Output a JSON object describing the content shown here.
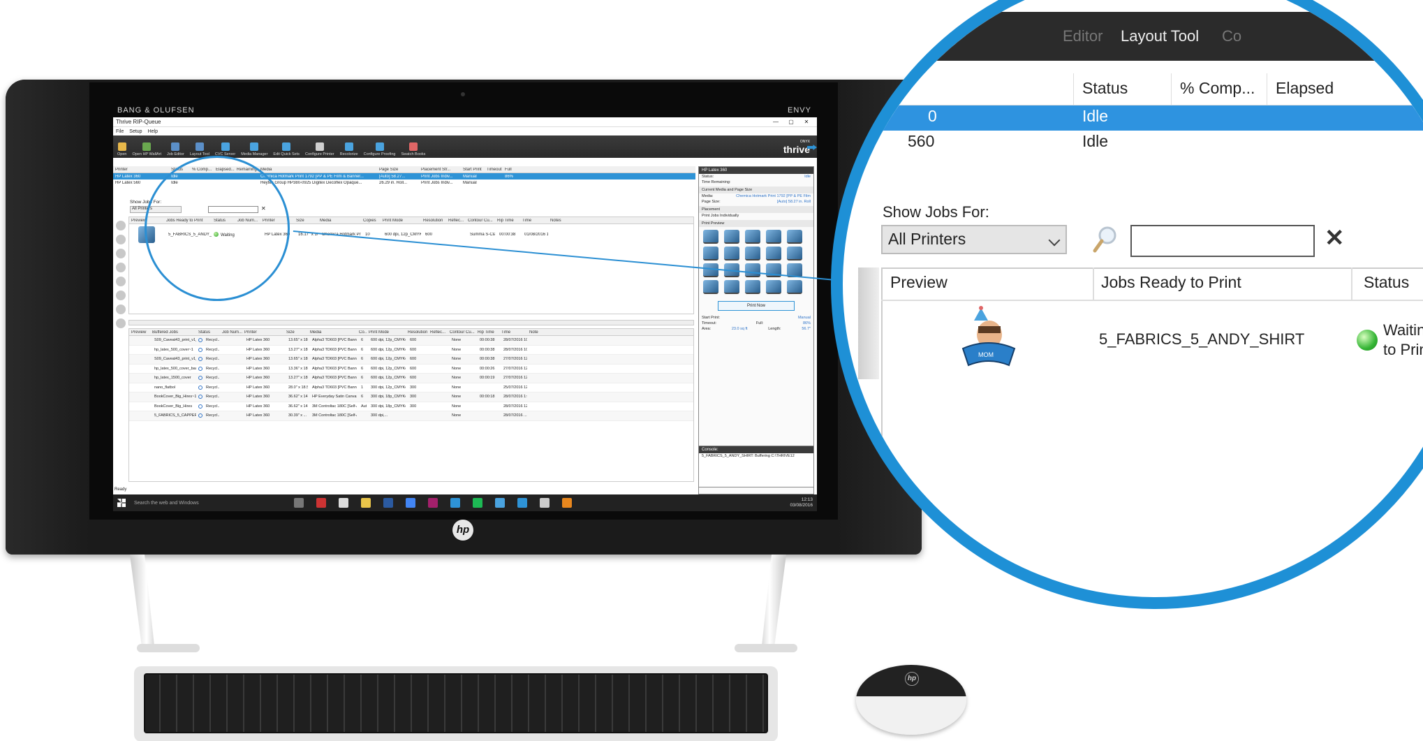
{
  "monitor": {
    "brand_left": "BANG & OLUFSEN",
    "brand_right": "ENVY"
  },
  "window": {
    "title": "Thrive RIP-Queue",
    "controls": [
      "—",
      "▢",
      "✕"
    ]
  },
  "menu": [
    "File",
    "Setup",
    "Help"
  ],
  "toolbar": [
    {
      "label": "Open",
      "icon": "folder-icon",
      "color": "#e8b84a"
    },
    {
      "label": "Open HP WallArt",
      "icon": "wallart-icon",
      "color": "#6aa84f"
    },
    {
      "label": "Job Editor",
      "icon": "job-editor-icon",
      "color": "#5b8fc8"
    },
    {
      "label": "Layout Tool",
      "icon": "layout-tool-icon",
      "color": "#5b8fc8"
    },
    {
      "label": "CVC Server",
      "icon": "cvc-server-icon",
      "color": "#4aa3df"
    },
    {
      "label": "Media Manager",
      "icon": "media-manager-icon",
      "color": "#4aa3df"
    },
    {
      "label": "Edit Quick Sets",
      "icon": "quick-sets-icon",
      "color": "#4aa3df"
    },
    {
      "label": "Configure Printer",
      "icon": "printer-icon",
      "color": "#cfcfcf"
    },
    {
      "label": "Recolorize",
      "icon": "recolorize-icon",
      "color": "#4aa3df"
    },
    {
      "label": "Configure Proofing",
      "icon": "proofing-icon",
      "color": "#4aa3df"
    },
    {
      "label": "Swatch Books",
      "icon": "swatch-books-icon",
      "color": "#e06666"
    }
  ],
  "brand": {
    "small": "ONYX",
    "name": "thrive"
  },
  "printer_grid": {
    "headers": [
      "Printer",
      "Status",
      "% Comp...",
      "Elapsed...",
      "Remaining...",
      "Media",
      "Page Size",
      "Placement Str...",
      "Start Print",
      "Timeout",
      "Full"
    ],
    "rows": [
      {
        "printer": "HP Latex 360",
        "status": "Idle",
        "media": "Chemica Hotmark Print 1792 [PP & PE Film & Banner...",
        "page_size": "[Auto] 58.27...",
        "placement": "Print Jobs Indiv...",
        "start": "Manual",
        "full": "86%"
      },
      {
        "printer": "HP Latex 560",
        "status": "Idle",
        "media": "Heytex Group HP380-0925 Digitex Decoflex Opaque...",
        "page_size": "26.29 in. Roll...",
        "placement": "Print Jobs Indiv...",
        "start": "Manual",
        "full": ""
      }
    ]
  },
  "show_jobs": {
    "label": "Show Jobs For:",
    "value": "All Printers",
    "clear": "✕"
  },
  "ready_grid": {
    "headers": [
      "Preview",
      "Jobs Ready to Print",
      "Status",
      "Job Num...",
      "Printer",
      "Size",
      "Media",
      "Copies",
      "Print Mode",
      "Resolution",
      "Reflec...",
      "Contour Cu...",
      "Rip Time",
      "Time",
      "Notes"
    ],
    "rows": [
      {
        "job": "5_FABRICS_5_ANDY_SHIRT",
        "status": "Waiting to Print",
        "printer": "HP Latex 360",
        "size": "16.17\" x 16.46\"",
        "media": "Chemica Hotmark Print 1792 [PP & PE Film & Banner]",
        "copies": "10",
        "mode": "600 dpi, 12p_CMYKcm_120",
        "resolution": "600",
        "contour": "Summa S-Class",
        "rip": "00:00:38",
        "time": "01/08/2016 12:50:23 PM"
      }
    ]
  },
  "buffered_grid": {
    "headers": [
      "Preview",
      "Buffered Jobs",
      "Status",
      "Job Num...",
      "Printer",
      "Size",
      "Media",
      "Co...",
      "Print Mode",
      "Resolution",
      "Reflec...",
      "Contour Cu...",
      "Rip Time",
      "Time",
      "Note"
    ],
    "rows": [
      {
        "job": "S09_Caveat43_print_v1_alpha~1",
        "status": "Recycl...",
        "printer": "HP Latex 360",
        "size": "13.65\" x 18.65\"",
        "media": "Alpha3 TD603 [PVC Banner]",
        "copies": "6",
        "mode": "600 dpi, 12p_CMYKcm_120",
        "res": "600",
        "contour": "None",
        "rip": "00:00:38",
        "time": "28/07/2016 10:44:25 AM",
        "wide": false
      },
      {
        "job": "hp_latex_500_cover~1",
        "status": "Recycl...",
        "printer": "HP Latex 360",
        "size": "13.27\" x 18.11\"",
        "media": "Alpha3 TD603 [PVC Banner]",
        "copies": "6",
        "mode": "600 dpi, 12p_CMYKcm_120",
        "res": "600",
        "contour": "None",
        "rip": "00:00:38",
        "time": "28/07/2016 10:02:25 AM",
        "wide": false
      },
      {
        "job": "S09_Caveat43_print_v1_alpha",
        "status": "Recycl...",
        "printer": "HP Latex 360",
        "size": "13.65\" x 18.65\"",
        "media": "Alpha3 TD603 [PVC Banner]",
        "copies": "6",
        "mode": "600 dpi, 12p_CMYKcm_120",
        "res": "600",
        "contour": "None",
        "rip": "00:00:38",
        "time": "27/07/2016 12:47:20 PM",
        "wide": false
      },
      {
        "job": "hp_latex_500_cover_back",
        "status": "Recycl...",
        "printer": "HP Latex 360",
        "size": "13.36\" x 18.11\"",
        "media": "Alpha3 TD603 [PVC Banner]",
        "copies": "6",
        "mode": "600 dpi, 12p_CMYKcm_120",
        "res": "600",
        "contour": "None",
        "rip": "00:00:26",
        "time": "27/07/2016 12:47:20 PM",
        "wide": false
      },
      {
        "job": "hp_latex_1500_cover",
        "status": "Recycl...",
        "printer": "HP Latex 360",
        "size": "13.27\" x 18.11\"",
        "media": "Alpha3 TD603 [PVC Banner]",
        "copies": "6",
        "mode": "600 dpi, 12p_CMYKcm_120",
        "res": "600",
        "contour": "None",
        "rip": "00:00:19",
        "time": "27/07/2016 12:30:31 PM",
        "wide": false
      },
      {
        "job": "nano_flatbol",
        "status": "Recycl...",
        "printer": "HP Latex 360",
        "size": "28.0\" x 18.50\"",
        "media": "Alpha3 TD603 [PVC Banner]",
        "copies": "1",
        "mode": "300 dpi, 12p_CMYKcm_110",
        "res": "300",
        "contour": "None",
        "rip": "",
        "time": "25/07/2016 12:36:26 PM",
        "wide": true
      },
      {
        "job": "BookCover_Big_Hires~1",
        "status": "Recycl...",
        "printer": "HP Latex 360",
        "size": "36.62\" x 14.65\"",
        "media": "HP Everyday Satin Canvas [Textile]",
        "copies": "6",
        "mode": "300 dpi, 18p_CMYKcm_100",
        "res": "300",
        "contour": "None",
        "rip": "00:00:18",
        "time": "28/07/2016 1:01:42 PM",
        "wide": true
      },
      {
        "job": "BookCover_Big_Hires",
        "status": "Recycl...",
        "printer": "HP Latex 360",
        "size": "36.62\" x 14.06\"",
        "media": "3M Controltac 180C [Self-Adhesive Vinyl]",
        "copies": "Auto",
        "mode": "300 dpi, 18p_CMYKcm_100",
        "res": "300",
        "contour": "None",
        "rip": "",
        "time": "28/07/2016 12:58:32 PM",
        "wide": true
      },
      {
        "job": "5_FABRICS_5_CAPPER_Bo...",
        "status": "Recycl...",
        "printer": "HP Latex 360",
        "size": "30.39\" x ...",
        "media": "3M Controltac 180C [Self-Adhesive ...",
        "copies": "",
        "mode": "300 dpi,...",
        "res": "",
        "contour": "None",
        "rip": "",
        "time": "28/07/2016 ...",
        "wide": true
      }
    ]
  },
  "panel": {
    "title": "HP Latex 360",
    "status_label": "Status:",
    "status_value": "Idle",
    "time_label": "Time Remaining:",
    "current_media": "Current Media and Page Size",
    "media_label": "Media:",
    "media_value": "Chemica Hotmark Print 1792 [PP & PE Film",
    "page_label": "Page Size:",
    "page_value": "[Auto] 58.27 in. Roll",
    "placement_label": "Placement",
    "placement_value": "Print Jobs Individually",
    "preview_label": "Print Preview",
    "print_now": "Print Now",
    "start_label": "Start Print:",
    "start_value": "Manual",
    "timeout_label": "Timeout:",
    "full_label": "Full:",
    "full_value": "86%",
    "area_label": "Area:",
    "area_value": "23.0 sq ft",
    "length_label": "Length:",
    "length_value": "56.7\""
  },
  "console": {
    "title": "Console:",
    "text": "5_FABRICS_5_ANDY_SHIRT: Buffering C:\\THRIVE12"
  },
  "status_bar": "Ready",
  "taskbar": {
    "search": "Search the web and Windows",
    "time": "12:13",
    "date": "03/08/2016",
    "apps": [
      {
        "icon": "task-view-icon",
        "color": "#777"
      },
      {
        "icon": "app-red-icon",
        "color": "#c33"
      },
      {
        "icon": "store-icon",
        "color": "#ddd"
      },
      {
        "icon": "explorer-icon",
        "color": "#e8c44a"
      },
      {
        "icon": "photoshop-icon",
        "color": "#2b5aa0"
      },
      {
        "icon": "chrome-icon",
        "color": "#4285f4"
      },
      {
        "icon": "indesign-icon",
        "color": "#a3206b"
      },
      {
        "icon": "thrive-icon",
        "color": "#2e93d6"
      },
      {
        "icon": "spotify-icon",
        "color": "#1db954"
      },
      {
        "icon": "app-blue-icon",
        "color": "#4aa3df"
      },
      {
        "icon": "app-blue2-icon",
        "color": "#2e93d6"
      },
      {
        "icon": "app-feather-icon",
        "color": "#ccc"
      },
      {
        "icon": "illustrator-icon",
        "color": "#e8871e"
      }
    ]
  },
  "zoom": {
    "tabs": [
      "Editor",
      "Layout Tool",
      "Co"
    ],
    "headers": [
      "Status",
      "% Comp...",
      "Elapsed"
    ],
    "rows": [
      {
        "printer": "0",
        "status": "Idle"
      },
      {
        "printer": "560",
        "status": "Idle"
      }
    ],
    "show_jobs_label": "Show Jobs For:",
    "select_value": "All Printers",
    "grid_headers": [
      "Preview",
      "Jobs Ready to Print",
      "Status"
    ],
    "job": "5_FABRICS_5_ANDY_SHIRT",
    "status_line1": "Waitin",
    "status_line2": "to Prin"
  }
}
